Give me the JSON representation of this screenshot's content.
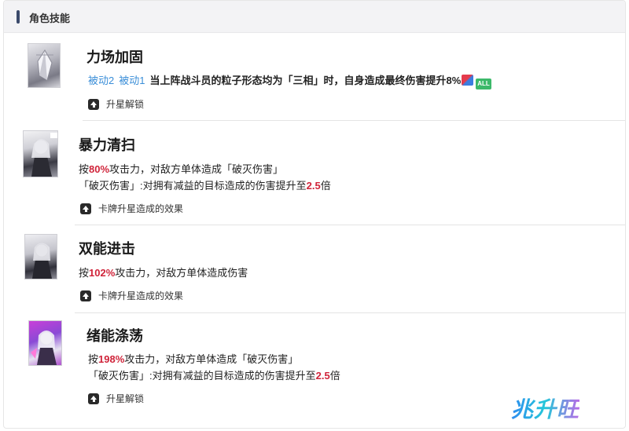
{
  "panel": {
    "title": "角色技能"
  },
  "skills": [
    {
      "name": "力场加固",
      "tags": [
        "被动2",
        "被动1"
      ],
      "lines": [
        {
          "parts": [
            {
              "text": "当上阵战斗员的粒子形态均为「三相」时，自身造成最终伤害提升8%",
              "hl": false
            }
          ]
        }
      ],
      "badge_label": "ALL",
      "upgrade_label": "升星解锁"
    },
    {
      "name": "暴力清扫",
      "lines": [
        {
          "parts": [
            {
              "text": "按",
              "hl": false
            },
            {
              "text": "80%",
              "hl": true
            },
            {
              "text": "攻击力，对敌方单体造成「破灭伤害」",
              "hl": false
            }
          ]
        },
        {
          "parts": [
            {
              "text": "「破灭伤害」:对拥有减益的目标造成的伤害提升至",
              "hl": false
            },
            {
              "text": "2.5",
              "hl": true
            },
            {
              "text": "倍",
              "hl": false
            }
          ]
        }
      ],
      "upgrade_label": "卡牌升星造成的效果"
    },
    {
      "name": "双能进击",
      "lines": [
        {
          "parts": [
            {
              "text": "按",
              "hl": false
            },
            {
              "text": "102%",
              "hl": true
            },
            {
              "text": "攻击力，对敌方单体造成伤害",
              "hl": false
            }
          ]
        }
      ],
      "upgrade_label": "卡牌升星造成的效果"
    },
    {
      "name": "绪能涤荡",
      "lines": [
        {
          "parts": [
            {
              "text": "按",
              "hl": false
            },
            {
              "text": "198%",
              "hl": true
            },
            {
              "text": "攻击力，对敌方单体造成「破灭伤害」",
              "hl": false
            }
          ]
        },
        {
          "parts": [
            {
              "text": "「破灭伤害」:对拥有减益的目标造成的伤害提升至",
              "hl": false
            },
            {
              "text": "2.5",
              "hl": true
            },
            {
              "text": "倍",
              "hl": false
            }
          ]
        }
      ],
      "upgrade_label": "升星解锁"
    }
  ],
  "watermark": {
    "text": "兆升旺"
  },
  "colors": {
    "highlight": "#d0243a",
    "tag": "#3a8ed8",
    "accent_bar": "#3b4a6b"
  }
}
